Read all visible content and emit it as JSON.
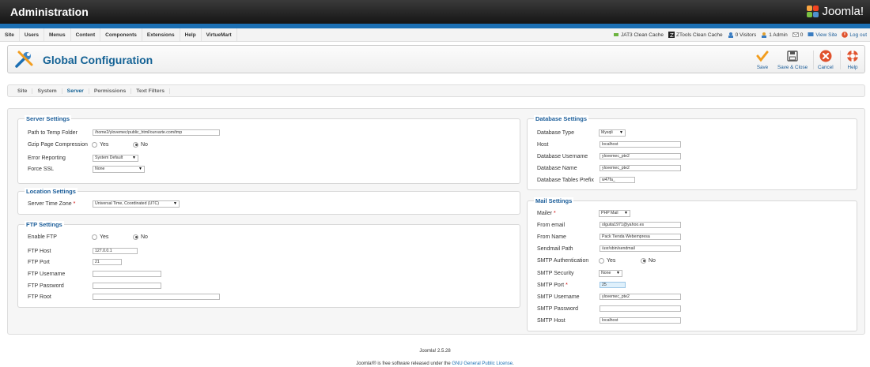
{
  "header": {
    "title": "Administration",
    "brand": "Joomla!"
  },
  "menu": [
    "Site",
    "Users",
    "Menus",
    "Content",
    "Components",
    "Extensions",
    "Help",
    "VirtueMart"
  ],
  "status": {
    "jat3": "JAT3 Clean Cache",
    "ztools": "ZTools Clean Cache",
    "visitors": "0 Visitors",
    "admin": "1 Admin",
    "messages": "0",
    "view_site": "View Site",
    "logout": "Log out"
  },
  "toolbar": {
    "title": "Global Configuration",
    "save": "Save",
    "save_close": "Save & Close",
    "cancel": "Cancel",
    "help": "Help"
  },
  "tabs": [
    "Site",
    "System",
    "Server",
    "Permissions",
    "Text Filters"
  ],
  "server": {
    "legend": "Server Settings",
    "temp_label": "Path to Temp Folder",
    "temp_value": "/home2/ylovemec/public_html/ourvarte.com/tmp",
    "gzip_label": "Gzip Page Compression",
    "yes": "Yes",
    "no": "No",
    "error_label": "Error Reporting",
    "error_value": "System Default",
    "ssl_label": "Force SSL",
    "ssl_value": "None"
  },
  "location": {
    "legend": "Location Settings",
    "tz_label": "Server Time Zone",
    "tz_value": "Universal Time, Coordinated (UTC)"
  },
  "ftp": {
    "legend": "FTP Settings",
    "enable_label": "Enable FTP",
    "yes": "Yes",
    "no": "No",
    "host_label": "FTP Host",
    "host_value": "127.0.0.1",
    "port_label": "FTP Port",
    "port_value": "21",
    "user_label": "FTP Username",
    "pass_label": "FTP Password",
    "root_label": "FTP Root"
  },
  "database": {
    "legend": "Database Settings",
    "type_label": "Database Type",
    "type_value": "Mysqli",
    "host_label": "Host",
    "host_value": "localhost",
    "user_label": "Database Username",
    "user_value": "ylovemec_pte2",
    "name_label": "Database Name",
    "name_value": "ylovemec_pte2",
    "prefix_label": "Database Tables Prefix",
    "prefix_value": "w47fa_"
  },
  "mail": {
    "legend": "Mail Settings",
    "mailer_label": "Mailer",
    "mailer_value": "PHP Mail",
    "from_email_label": "From email",
    "from_email_value": "olguita1971@yahoo.es",
    "from_name_label": "From Name",
    "from_name_value": "Pack Tienda Webempresa",
    "sendmail_label": "Sendmail Path",
    "sendmail_value": "/usr/sbin/sendmail",
    "auth_label": "SMTP Authentication",
    "yes": "Yes",
    "no": "No",
    "security_label": "SMTP Security",
    "security_value": "None",
    "port_label": "SMTP Port",
    "port_value": "25",
    "user_label": "SMTP Username",
    "user_value": "ylovemec_pte2",
    "pass_label": "SMTP Password",
    "host_label": "SMTP Host",
    "host_value": "localhost"
  },
  "footer": {
    "version": "Joomla! 2.5.28",
    "license_pre": "Joomla!® is free software released under the ",
    "license_link": "GNU General Public License",
    "license_post": "."
  }
}
